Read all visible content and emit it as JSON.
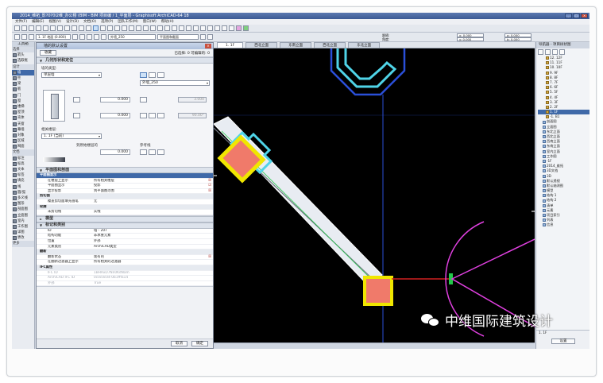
{
  "window": {
    "title": "2014_维拓_影?0?0i2维_办公楼 (BIM - BIM 项目编 / 1_平面层 - Graphisoft ArchiCAD-64 18",
    "controls": [
      "_",
      "□",
      "×"
    ]
  },
  "menubar": [
    "文件(F)",
    "编辑(E)",
    "视图(V)",
    "设计(D)",
    "文档(O)",
    "选项(P)",
    "团队工作(M)",
    "窗口(W)",
    "帮助(H)"
  ],
  "toolbar": {
    "layer_combo": "外墙_250",
    "drawing_combo": "平面图和截面",
    "coord_labels": [
      "跟随:",
      "角度:"
    ],
    "coord_values": [
      "x: 0.000",
      "y: 0.000",
      "a: 0.000",
      "b: 0.000"
    ],
    "floor_label": "1. 1F 地面 (0.000)"
  },
  "toolbox": {
    "title": "工具箱",
    "select": "选择",
    "items": [
      {
        "label": "箭头",
        "type": "tool"
      },
      {
        "label": "选取框",
        "type": "tool"
      },
      {
        "label": "设计",
        "type": "header"
      },
      {
        "label": "墙",
        "type": "tool",
        "selected": true
      },
      {
        "label": "柱",
        "type": "tool"
      },
      {
        "label": "梁",
        "type": "tool"
      },
      {
        "label": "板",
        "type": "tool"
      },
      {
        "label": "门",
        "type": "tool"
      },
      {
        "label": "窗",
        "type": "tool"
      },
      {
        "label": "楼梯",
        "type": "tool"
      },
      {
        "label": "屋顶",
        "type": "tool"
      },
      {
        "label": "壳体",
        "type": "tool"
      },
      {
        "label": "天窗",
        "type": "tool"
      },
      {
        "label": "幕墙",
        "type": "tool"
      },
      {
        "label": "对象",
        "type": "tool"
      },
      {
        "label": "区域",
        "type": "tool"
      },
      {
        "label": "网面",
        "type": "tool"
      },
      {
        "label": "文档",
        "type": "header"
      },
      {
        "label": "标注",
        "type": "tool"
      },
      {
        "label": "标高",
        "type": "tool"
      },
      {
        "label": "文本",
        "type": "tool"
      },
      {
        "label": "标签",
        "type": "tool"
      },
      {
        "label": "填充",
        "type": "tool"
      },
      {
        "label": "线",
        "type": "tool"
      },
      {
        "label": "圆/弧",
        "type": "tool"
      },
      {
        "label": "多义线",
        "type": "tool"
      },
      {
        "label": "图形",
        "type": "tool"
      },
      {
        "label": "剖面图",
        "type": "tool"
      },
      {
        "label": "立面图",
        "type": "tool"
      },
      {
        "label": "室内",
        "type": "tool"
      },
      {
        "label": "工作图",
        "type": "tool"
      },
      {
        "label": "详图",
        "type": "tool"
      },
      {
        "label": "更改",
        "type": "tool"
      },
      {
        "label": "更多",
        "type": "header"
      }
    ]
  },
  "dialog": {
    "title": "墙的默认设置",
    "favorites_button": "收藏",
    "selected_info": "已选择: 0   可编辑的: 0",
    "geometry_section": "几何形状和定位",
    "structure_label": "墙的类型:",
    "structure_value": "单层墙",
    "layer_value": "外墙_250",
    "field_top": "0.000",
    "field_bottom": "0.000",
    "field_height": "3.000",
    "field_angle": "90.00°",
    "home_story_label": "相关楼层:",
    "home_story_value": "1. 1F (当前)",
    "offset_label": "到原始楼层的",
    "offset_value": "0.000",
    "ref_label": "参考线",
    "floorplan_section": "平面图和剖面",
    "properties": [
      {
        "name": "平面图显示",
        "value": "",
        "type": "group",
        "selected": true
      },
      {
        "name": "在楼层上显示",
        "value": "所有相关楼层",
        "check": "☒"
      },
      {
        "name": "平面图显示",
        "value": "投影",
        "check": "☑"
      },
      {
        "name": "显示投影",
        "value": "到平面图范围",
        "check": "☒"
      },
      {
        "name": "剪切面",
        "value": "",
        "type": "group"
      },
      {
        "name": "覆盖剪切面填充画笔",
        "value": "无"
      },
      {
        "name": "轮廓",
        "value": "",
        "type": "group"
      },
      {
        "name": "未剪切线",
        "value": "实线"
      }
    ],
    "model_section": "模型",
    "listing_section": "标记和类别",
    "tags": [
      {
        "name": "ID",
        "value": "墙 - 207"
      },
      {
        "name": "结构功能",
        "value": "非承重元素"
      },
      {
        "name": "位置",
        "value": "外部"
      },
      {
        "name": "元素类别",
        "value": "ArchiCAD类型"
      },
      {
        "name": "翻新",
        "value": "",
        "type": "group"
      },
      {
        "name": "翻新状态",
        "value": "现有的",
        "check": "☒"
      },
      {
        "name": "在翻新过滤器上显示",
        "value": "所有相关的过滤器"
      },
      {
        "name": "IFC属性",
        "value": "",
        "type": "group"
      },
      {
        "name": "IFC ID",
        "value": "1BHAxD7Nn0KdNam",
        "dim": true
      },
      {
        "name": "ArchiCAD IFC ID",
        "value": "0c0c0c04-0b1fffa14",
        "dim": true
      },
      {
        "name": "外部",
        "value": "True",
        "dim": true
      }
    ],
    "cancel": "取消",
    "ok": "确定"
  },
  "view_tabs": [
    "1. 1F",
    "西北立面",
    "东南立面",
    "西北立面",
    "东北立面"
  ],
  "navigator": {
    "title": "导航器 - 项目树状图",
    "stories": [
      "12. 12F",
      "11. 11F",
      "10. 10F",
      "9. 9F",
      "8. 8F",
      "7. 7F",
      "6. 6F",
      "5. 5F",
      "4. 4F",
      "3. 3F",
      "2. 2F",
      "1. 1F",
      "-1. B1"
    ],
    "groups": [
      "剖面图",
      "立面图",
      "东北立面",
      "西北立面",
      "西南立面",
      "东南立面",
      "室内立面",
      "工作图",
      "-1F",
      "2014_维拓",
      "3D文档",
      "3D",
      "默认透视",
      "默认轴测图",
      "模型",
      "结构 1",
      "结构 2",
      "清单",
      "元素",
      "项目索引",
      "列表",
      "信息"
    ],
    "bottom": [
      "1. 1F",
      "设置"
    ]
  },
  "canvas_tags": [
    "⊕ ⊖"
  ],
  "watermark": "中维国际建筑设计",
  "colors": {
    "canvas_bg": "#000000",
    "wall_fill": "#e8ecf2",
    "column_yellow": "#f0e600",
    "column_fill": "#f07a6a",
    "cyan": "#4fd4e8",
    "blue_axis": "#2a4fd8",
    "magenta": "#e040e0",
    "green": "#22c84a",
    "red": "#d02020"
  }
}
